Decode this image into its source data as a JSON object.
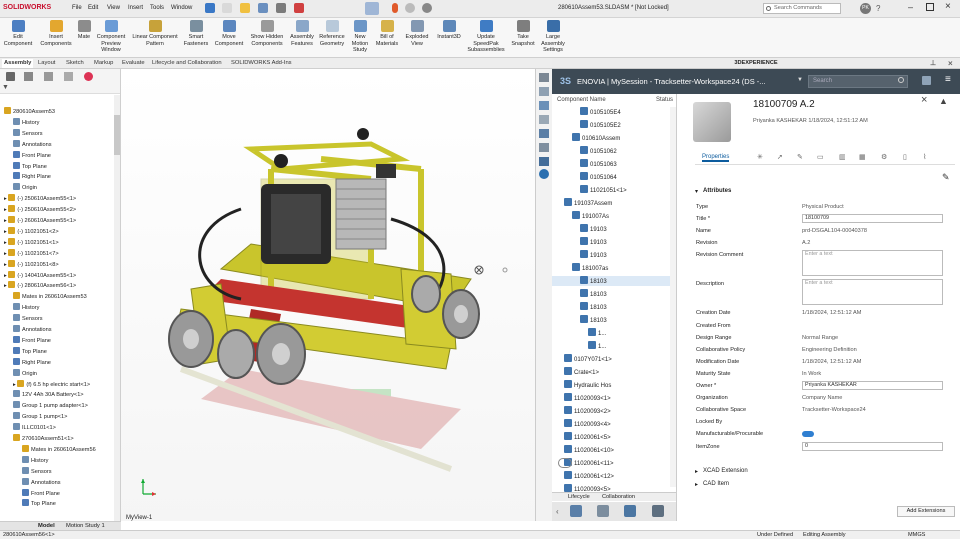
{
  "title": {
    "app": "SOLIDWORKS",
    "menus": [
      "File",
      "Edit",
      "View",
      "Insert",
      "Tools",
      "Window"
    ],
    "doc": "280610Assem53.SLDASM * [Not Locked]",
    "search": "Search Commands",
    "avatar": "PK"
  },
  "ribbon": [
    "Edit Component",
    "Insert Components",
    "Mate",
    "Component Preview Window",
    "Linear Component Pattern",
    "Smart Fasteners",
    "Move Component",
    "Show Hidden Components",
    "Assembly Features",
    "Reference Geometry",
    "New Motion Study",
    "Bill of Materials",
    "Exploded View",
    "Instant3D",
    "Update SpeedPak Subassemblies",
    "Take Snapshot",
    "Large Assembly Settings"
  ],
  "tabs": [
    "Assembly",
    "Layout",
    "Sketch",
    "Markup",
    "Evaluate",
    "Lifecycle and Collaboration",
    "SOLIDWORKS Add-Ins"
  ],
  "tree": [
    {
      "l": "280610Assem53",
      "d": 0
    },
    {
      "l": "History",
      "d": 1
    },
    {
      "l": "Sensors",
      "d": 1
    },
    {
      "l": "Annotations",
      "d": 1
    },
    {
      "l": "Front Plane",
      "d": 1
    },
    {
      "l": "Top Plane",
      "d": 1
    },
    {
      "l": "Right Plane",
      "d": 1
    },
    {
      "l": "Origin",
      "d": 1
    },
    {
      "l": "(-) 250610Assem55<1>",
      "d": 0
    },
    {
      "l": "(-) 250610Assem55<2>",
      "d": 0
    },
    {
      "l": "(-) 260610Assem55<1>",
      "d": 0
    },
    {
      "l": "(-) 11021051<2>",
      "d": 0
    },
    {
      "l": "(-) 11021051<1>",
      "d": 0
    },
    {
      "l": "(-) 11021051<7>",
      "d": 0
    },
    {
      "l": "(-) 11021051<8>",
      "d": 0
    },
    {
      "l": "(-) 140410Assem55<1>",
      "d": 0
    },
    {
      "l": "(-) 280610Assem56<1>",
      "d": 0
    },
    {
      "l": "Mates in 260610Assem53",
      "d": 1
    },
    {
      "l": "History",
      "d": 1
    },
    {
      "l": "Sensors",
      "d": 1
    },
    {
      "l": "Annotations",
      "d": 1
    },
    {
      "l": "Front Plane",
      "d": 1
    },
    {
      "l": "Top Plane",
      "d": 1
    },
    {
      "l": "Right Plane",
      "d": 1
    },
    {
      "l": "Origin",
      "d": 1
    },
    {
      "l": "(f) 6.5 hp electric start<1>",
      "d": 1
    },
    {
      "l": "12V 4Ah 30A Battery<1>",
      "d": 1
    },
    {
      "l": "Group 1 pump adapter<1>",
      "d": 1
    },
    {
      "l": "Group 1 pump<1>",
      "d": 1
    },
    {
      "l": "ILLC0101<1>",
      "d": 1
    },
    {
      "l": "270610Assem51<1>",
      "d": 1
    },
    {
      "l": "Mates in 260610Assem56",
      "d": 2
    },
    {
      "l": "History",
      "d": 2
    },
    {
      "l": "Sensors",
      "d": 2
    },
    {
      "l": "Annotations",
      "d": 2
    },
    {
      "l": "Front Plane",
      "d": 2
    },
    {
      "l": "Top Plane",
      "d": 2
    }
  ],
  "bottom_tabs": [
    "Model",
    "Motion Study 1"
  ],
  "status": {
    "left": "280610Assem56<1>",
    "a": "Under Defined",
    "b": "Editing Assembly",
    "c": "MMGS"
  },
  "viewport_label": "MyView-1",
  "panel_title": "3DEXPERIENCE",
  "enovia": {
    "title": "ENOVIA | MySession - Tracksetter-Workspace24 (DS -...",
    "search": "Search"
  },
  "etree_header": {
    "c1": "Component Name",
    "c2": "Status"
  },
  "etree": [
    {
      "l": "0105105E4",
      "d": 3
    },
    {
      "l": "0105105E2",
      "d": 3
    },
    {
      "l": "010610Assem",
      "d": 2
    },
    {
      "l": "01051062",
      "d": 3
    },
    {
      "l": "01051063",
      "d": 3
    },
    {
      "l": "01051064",
      "d": 3
    },
    {
      "l": "11021051<1>",
      "d": 3
    },
    {
      "l": "191037Assem",
      "d": 1
    },
    {
      "l": "191007As",
      "d": 2
    },
    {
      "l": "19103",
      "d": 3
    },
    {
      "l": "19103",
      "d": 3
    },
    {
      "l": "19103",
      "d": 3
    },
    {
      "l": "181007as",
      "d": 2
    },
    {
      "l": "18103",
      "d": 3
    },
    {
      "l": "18103",
      "d": 3
    },
    {
      "l": "18103",
      "d": 3
    },
    {
      "l": "18103",
      "d": 3
    },
    {
      "l": "1...",
      "d": 4
    },
    {
      "l": "1...",
      "d": 4
    },
    {
      "l": "0107Y071<1>",
      "d": 1
    },
    {
      "l": "Crate<1>",
      "d": 1
    },
    {
      "l": "Hydraulic Hos",
      "d": 1
    },
    {
      "l": "11020093<1>",
      "d": 1
    },
    {
      "l": "11020093<2>",
      "d": 1
    },
    {
      "l": "11020093<4>",
      "d": 1
    },
    {
      "l": "11020061<5>",
      "d": 1
    },
    {
      "l": "11020061<10>",
      "d": 1
    },
    {
      "l": "11020061<11>",
      "d": 1
    },
    {
      "l": "11020061<12>",
      "d": 1
    },
    {
      "l": "11020093<5>",
      "d": 1
    }
  ],
  "etabs": [
    "Lifecycle",
    "Collaboration"
  ],
  "product": {
    "id": "18100709 A.2",
    "owner_line": "Priyanka KASHEKAR  1/18/2024, 12:51:12 AM",
    "tab": "Properties",
    "section": "Attributes",
    "more": [
      "XCAD Extension",
      "CAD Item"
    ],
    "button": "Add Extensions"
  },
  "props": [
    {
      "k": "Type",
      "v": "Physical Product",
      "t": "text"
    },
    {
      "k": "Title *",
      "v": "18100709",
      "t": "input"
    },
    {
      "k": "Name",
      "v": "prd-DSGAL104-00040378",
      "t": "text"
    },
    {
      "k": "Revision",
      "v": "A.2",
      "t": "text"
    },
    {
      "k": "Revision Comment",
      "v": "Enter a text",
      "t": "area"
    },
    {
      "k": "Description",
      "v": "Enter a text",
      "t": "area"
    },
    {
      "k": "Creation Date",
      "v": "1/18/2024, 12:51:12 AM",
      "t": "text"
    },
    {
      "k": "Created From",
      "v": "",
      "t": "text"
    },
    {
      "k": "Design Range",
      "v": "Normal Range",
      "t": "text"
    },
    {
      "k": "Collaborative Policy",
      "v": "Engineering Definition",
      "t": "text"
    },
    {
      "k": "Modification Date",
      "v": "1/18/2024, 12:51:12 AM",
      "t": "text"
    },
    {
      "k": "Maturity State",
      "v": "In Work",
      "t": "text"
    },
    {
      "k": "Owner *",
      "v": "Priyanka KASHEKAR",
      "t": "input"
    },
    {
      "k": "Organization",
      "v": "Company Name",
      "t": "text"
    },
    {
      "k": "Collaborative Space",
      "v": "Tracksetter-Workspace24",
      "t": "text"
    },
    {
      "k": "Locked By",
      "v": "",
      "t": "text"
    },
    {
      "k": "Manufacturable/Procurable",
      "v": "",
      "t": "toggle"
    },
    {
      "k": "ItemZone",
      "v": "0",
      "t": "input"
    }
  ],
  "colors": {
    "accent": "#0d5c9e",
    "frame": "#c8c62a",
    "enovia_bar": "#3d4a55"
  }
}
